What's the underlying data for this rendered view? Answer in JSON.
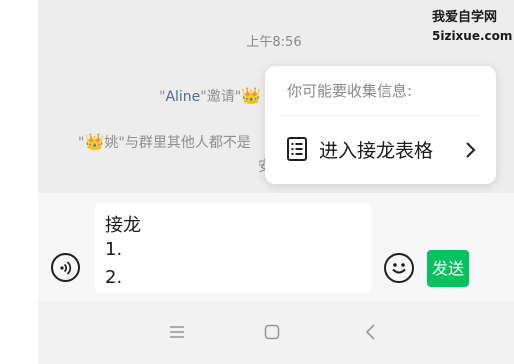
{
  "chat": {
    "time": "上午8:56",
    "invite_quote_open": "\"",
    "invite_name": "Aline",
    "invite_text": "\"邀请\"",
    "join_quote_open": "\"",
    "join_name": "姚",
    "join_text": "\"与群里其他人都不是",
    "join_line2": "安"
  },
  "popup": {
    "title": "你可能要收集信息:",
    "item_label": "进入接龙表格"
  },
  "input": {
    "lines": [
      "接龙",
      "1.",
      "2."
    ],
    "send_label": "发送"
  },
  "watermark": {
    "line1": "我爱自学网",
    "line2": "5izixue.com"
  },
  "icons": {
    "voice": "voice-icon",
    "emoji": "emoji-icon",
    "list": "list-icon",
    "chevron": "chevron-right-icon",
    "crown": "crown-icon",
    "menu": "menu-icon",
    "home": "home-icon",
    "back": "back-icon"
  },
  "colors": {
    "accent": "#07c160",
    "name_link": "#4e6a94",
    "background": "#ededed"
  }
}
